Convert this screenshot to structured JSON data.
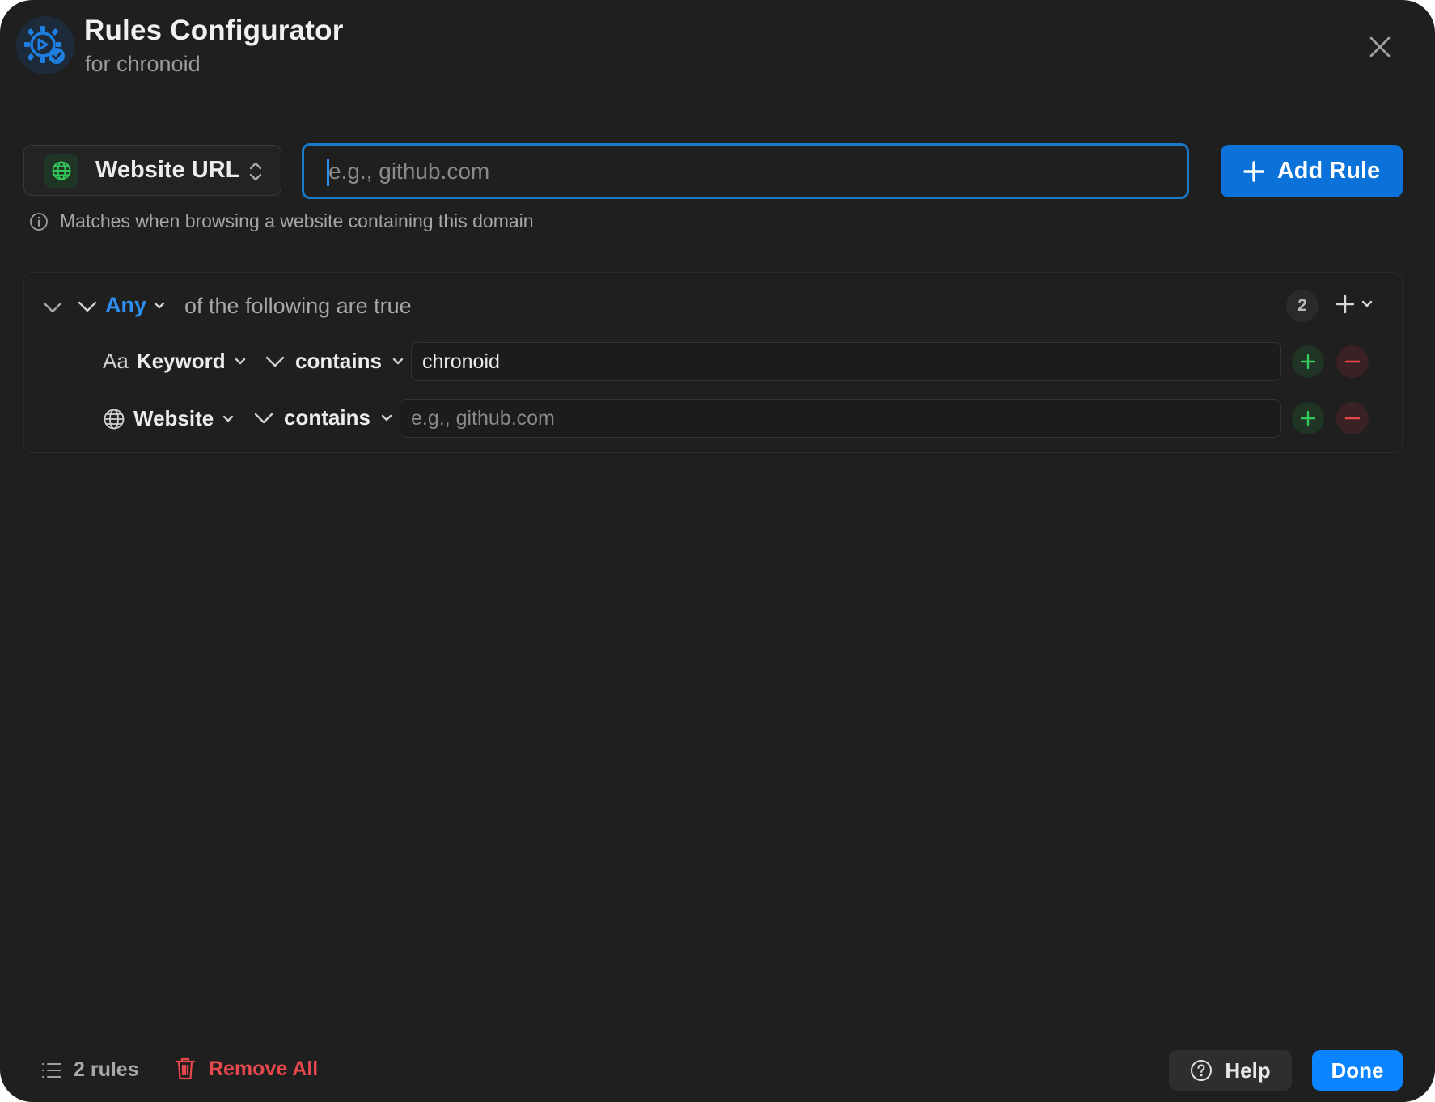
{
  "header": {
    "title": "Rules Configurator",
    "subtitle": "for chronoid",
    "app_icon": "gear-check-icon",
    "close_icon": "close-icon"
  },
  "rule_builder": {
    "type_selector": {
      "label": "Website URL",
      "icon": "globe-icon"
    },
    "url_input": {
      "value": "",
      "placeholder": "e.g., github.com"
    },
    "add_button": {
      "label": "Add Rule",
      "icon": "plus-icon"
    },
    "hint": {
      "icon": "info-icon",
      "text": "Matches when browsing a website containing this domain"
    }
  },
  "rule_group": {
    "quantifier": "Any",
    "suffix": "of the following are true",
    "count": "2",
    "rules": [
      {
        "field_prefix": "Aa",
        "field": "Keyword",
        "operator": "contains",
        "value": "chronoid",
        "placeholder": ""
      },
      {
        "field_icon": "globe-icon",
        "field": "Website",
        "operator": "contains",
        "value": "",
        "placeholder": "e.g., github.com"
      }
    ]
  },
  "footer": {
    "rules_count": "2 rules",
    "remove_all": "Remove All",
    "help": "Help",
    "done": "Done"
  },
  "colors": {
    "window_bg": "#1f1f1f",
    "accent_blue": "#0a84ff",
    "focus_border": "#1a78c9",
    "danger_red": "#e5484d",
    "success_green": "#34c759"
  }
}
